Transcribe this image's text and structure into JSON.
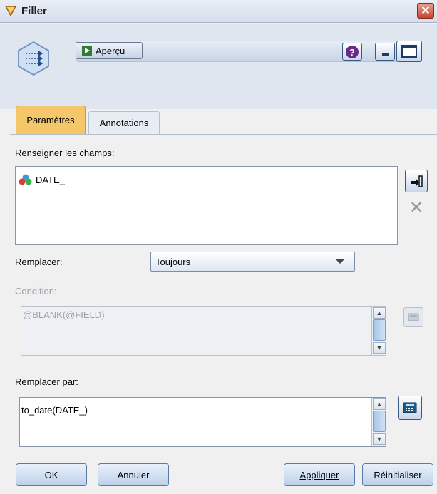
{
  "window": {
    "title": "Filler"
  },
  "toolbar": {
    "preview_label": "Aperçu",
    "help_symbol": "?",
    "close_symbol": "✕"
  },
  "tabs": [
    {
      "label": "Paramètres",
      "active": true
    },
    {
      "label": "Annotations",
      "active": false
    }
  ],
  "settings": {
    "fill_fields_label": "Renseigner les champs:",
    "fields": [
      {
        "name": "DATE_",
        "icon": "field-type-icon"
      }
    ],
    "replace_label": "Remplacer:",
    "replace_value": "Toujours",
    "condition_label": "Condition:",
    "condition_value": "@BLANK(@FIELD)",
    "replace_with_label": "Remplacer par:",
    "replace_with_value": "to_date(DATE_)"
  },
  "buttons": {
    "ok": "OK",
    "cancel": "Annuler",
    "apply": "Appliquer",
    "reset": "Réinitialiser"
  },
  "colors": {
    "active_tab": "#f4c86a",
    "accent_blue": "#3a5a86",
    "close_red": "#c9462f"
  }
}
